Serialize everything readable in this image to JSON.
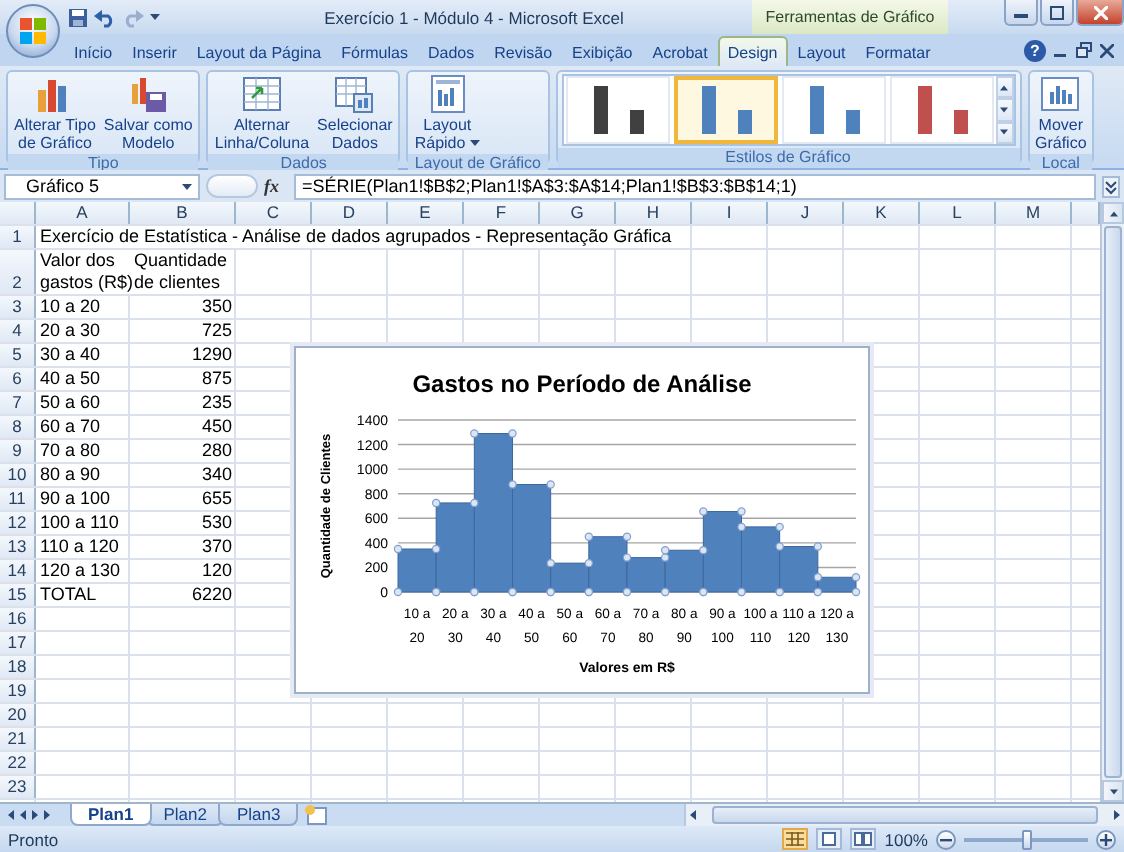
{
  "title_bar": {
    "title": "Exercício 1 - Módulo 4 - Microsoft Excel",
    "context_label": "Ferramentas de Gráfico"
  },
  "ribbon_tabs": [
    {
      "label": "Início",
      "selected": false
    },
    {
      "label": "Inserir",
      "selected": false
    },
    {
      "label": "Layout da Página",
      "selected": false
    },
    {
      "label": "Fórmulas",
      "selected": false
    },
    {
      "label": "Dados",
      "selected": false
    },
    {
      "label": "Revisão",
      "selected": false
    },
    {
      "label": "Exibição",
      "selected": false
    },
    {
      "label": "Acrobat",
      "selected": false
    },
    {
      "label": "Design",
      "selected": true
    },
    {
      "label": "Layout",
      "selected": false
    },
    {
      "label": "Formatar",
      "selected": false
    }
  ],
  "help_button": "?",
  "ribbon_groups": [
    {
      "label": "Tipo",
      "kind": "buttons",
      "buttons": [
        {
          "label": "Alterar Tipo\nde Gráfico"
        },
        {
          "label": "Salvar como\nModelo"
        }
      ]
    },
    {
      "label": "Dados",
      "kind": "buttons",
      "buttons": [
        {
          "label": "Alternar\nLinha/Coluna"
        },
        {
          "label": "Selecionar\nDados"
        }
      ]
    },
    {
      "label": "Layout de Gráfico",
      "kind": "buttons",
      "buttons": [
        {
          "label": "Layout\nRápido",
          "dropdown": true
        }
      ]
    },
    {
      "label": "Estilos de Gráfico",
      "kind": "gallery",
      "styles": [
        {
          "color": "#404040",
          "selected": false
        },
        {
          "color": "#4f81bd",
          "selected": true
        },
        {
          "color": "#4f81bd",
          "selected": false
        },
        {
          "color": "#c0504d",
          "selected": false
        }
      ]
    },
    {
      "label": "Local",
      "kind": "buttons",
      "buttons": [
        {
          "label": "Mover\nGráfico"
        }
      ]
    }
  ],
  "formula_bar": {
    "name_box": "Gráfico 5",
    "function_label": "fx",
    "formula": "=SÉRIE(Plan1!$B$2;Plan1!$A$3:$A$14;Plan1!$B$3:$B$14;1)"
  },
  "sheet": {
    "columns": [
      "A",
      "B",
      "C",
      "D",
      "E",
      "F",
      "G",
      "H",
      "I",
      "J",
      "K",
      "L",
      "M"
    ],
    "rows": [
      {
        "number": "1",
        "cells": [
          "Exercício de Estatística - Análise de dados agrupados - Representação Gráfica"
        ]
      },
      {
        "number": "2",
        "cells": [
          "Valor dos\ngastos (R$)",
          "Quantidade\nde clientes"
        ]
      },
      {
        "number": "3",
        "cells": [
          "10 a 20",
          {
            "text": "350",
            "kind": "number"
          }
        ]
      },
      {
        "number": "4",
        "cells": [
          "20 a 30",
          {
            "text": "725",
            "kind": "number"
          }
        ]
      },
      {
        "number": "5",
        "cells": [
          "30 a 40",
          {
            "text": "1290",
            "kind": "number"
          }
        ]
      },
      {
        "number": "6",
        "cells": [
          "40 a 50",
          {
            "text": "875",
            "kind": "number"
          }
        ]
      },
      {
        "number": "7",
        "cells": [
          "50 a 60",
          {
            "text": "235",
            "kind": "number"
          }
        ]
      },
      {
        "number": "8",
        "cells": [
          "60 a 70",
          {
            "text": "450",
            "kind": "number"
          }
        ]
      },
      {
        "number": "9",
        "cells": [
          "70 a 80",
          {
            "text": "280",
            "kind": "number"
          }
        ]
      },
      {
        "number": "10",
        "cells": [
          "80 a 90",
          {
            "text": "340",
            "kind": "number"
          }
        ]
      },
      {
        "number": "11",
        "cells": [
          "90 a 100",
          {
            "text": "655",
            "kind": "number"
          }
        ]
      },
      {
        "number": "12",
        "cells": [
          "100 a 110",
          {
            "text": "530",
            "kind": "number"
          }
        ]
      },
      {
        "number": "13",
        "cells": [
          "110 a 120",
          {
            "text": "370",
            "kind": "number"
          }
        ]
      },
      {
        "number": "14",
        "cells": [
          "120 a 130",
          {
            "text": "120",
            "kind": "number"
          }
        ]
      },
      {
        "number": "15",
        "cells": [
          "TOTAL",
          {
            "text": "6220",
            "kind": "number"
          }
        ]
      },
      {
        "number": "16"
      },
      {
        "number": "17"
      },
      {
        "number": "18"
      },
      {
        "number": "19"
      },
      {
        "number": "20"
      },
      {
        "number": "21"
      },
      {
        "number": "22"
      },
      {
        "number": "23"
      }
    ]
  },
  "chart": {
    "chart_data": {
      "type": "bar",
      "title": "Gastos no Período de Análise",
      "xlabel": "Valores em R$",
      "ylabel": "Quantidade de Clientes",
      "grid": true,
      "categories": [
        "10 a 20",
        "20 a 30",
        "30 a 40",
        "40 a 50",
        "50 a 60",
        "60 a 70",
        "70 a 80",
        "80 a 90",
        "90 a 100",
        "100 a 110",
        "110 a 120",
        "120 a 130"
      ],
      "series": [
        {
          "color": "#4f81bd",
          "values": [
            350,
            725,
            1290,
            875,
            235,
            450,
            280,
            340,
            655,
            530,
            370,
            120
          ]
        }
      ],
      "ylim": [
        0,
        1400
      ],
      "yticks": [
        0,
        200,
        400,
        600,
        800,
        1000,
        1200,
        1400
      ]
    }
  },
  "sheet_tabs": [
    {
      "label": "Plan1",
      "selected": true
    },
    {
      "label": "Plan2",
      "selected": false
    },
    {
      "label": "Plan3",
      "selected": false
    }
  ],
  "status_bar": {
    "status": "Pronto",
    "zoom": "100%",
    "zoom_slider": {
      "level": 0.5
    }
  }
}
